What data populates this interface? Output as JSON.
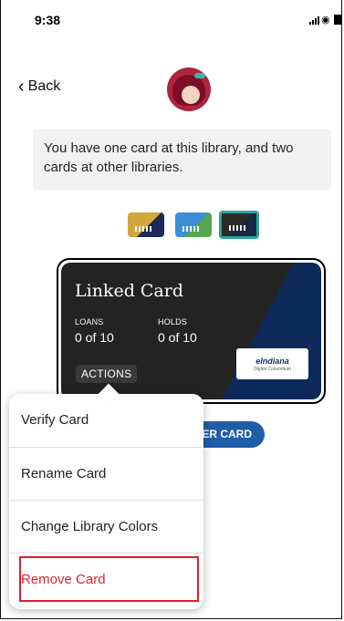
{
  "status_bar": {
    "time": "9:38"
  },
  "nav": {
    "back_label": "Back"
  },
  "info": {
    "message": "You have one card at this library, and two cards at other libraries."
  },
  "swatches": [
    {
      "selected": false,
      "colors": [
        "#d1a63c",
        "#1b2a56"
      ]
    },
    {
      "selected": false,
      "colors": [
        "#3d8ed6",
        "#55a550"
      ]
    },
    {
      "selected": true,
      "colors": [
        "#2a2a2a",
        "#1a2744"
      ]
    }
  ],
  "card": {
    "title": "Linked Card",
    "loans_label": "LOANS",
    "loans_value": "0 of 10",
    "holds_label": "HOLDS",
    "holds_value": "0 of 10",
    "actions_label": "ACTIONS",
    "library_logo_main": "eIndiana",
    "library_logo_sub": "Digital Consortium"
  },
  "register_button": {
    "label": "ER CARD"
  },
  "menu": {
    "items": [
      "Verify Card",
      "Rename Card",
      "Change Library Colors",
      "Remove Card"
    ]
  },
  "colors": {
    "accent": "#1f5ea8",
    "danger": "#e0242f",
    "highlight": "#e31b2b",
    "selected_ring": "#2ba59a"
  }
}
